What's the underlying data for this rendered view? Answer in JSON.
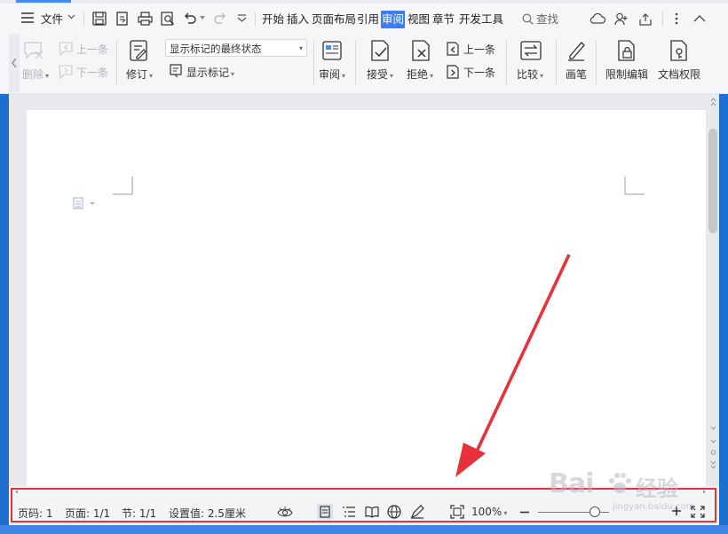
{
  "menu": {
    "file_label": "文件",
    "tabs": [
      "开始",
      "插入",
      "页面布局",
      "引用",
      "审阅",
      "视图",
      "章节",
      "开发工具"
    ],
    "active_tab": "审阅",
    "search_label": "查找"
  },
  "ribbon": {
    "delete_label": "删除",
    "prev_comment_label": "上一条",
    "next_comment_label": "下一条",
    "track_changes_label": "修订",
    "markup_select_value": "显示标记的最终状态",
    "show_markup_label": "显示标记",
    "review_label": "审阅",
    "accept_label": "接受",
    "reject_label": "拒绝",
    "prev_change_label": "上一条",
    "next_change_label": "下一条",
    "compare_label": "比较",
    "pen_label": "画笔",
    "restrict_edit_label": "限制编辑",
    "doc_permission_label": "文档权限"
  },
  "status": {
    "page_code": "页码: 1",
    "pages": "页面: 1/1",
    "section": "节: 1/1",
    "setting_value": "设置值: 2.5厘米",
    "zoom": "100%",
    "zoom_percent": 100
  },
  "watermark": {
    "brand": "Bai",
    "brand_tail": "经验",
    "url": "jingyan.baidu.com"
  },
  "colors": {
    "accent": "#3d7cf2",
    "annotation": "#e8323a",
    "desktop": "#1f6fcf"
  }
}
